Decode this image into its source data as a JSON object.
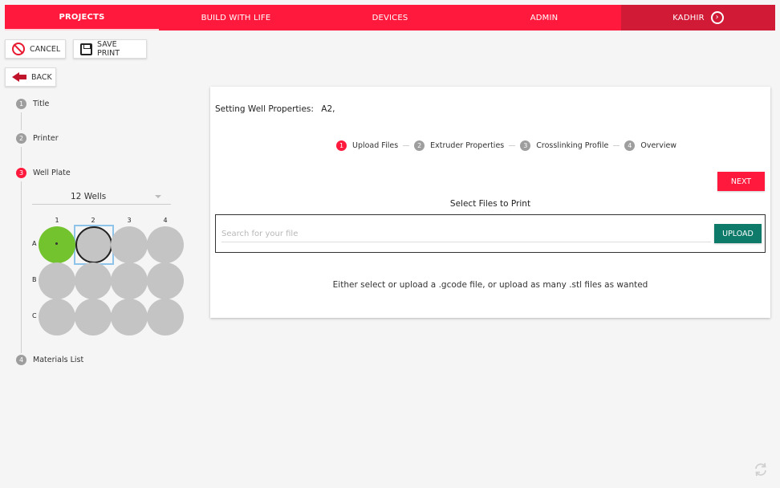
{
  "nav": {
    "items": [
      {
        "label": "PROJECTS",
        "active": true
      },
      {
        "label": "BUILD WITH LIFE",
        "active": false
      },
      {
        "label": "DEVICES",
        "active": false
      },
      {
        "label": "ADMIN",
        "active": false
      }
    ],
    "user": "KADHIR"
  },
  "toolbar": {
    "cancel_label": "CANCEL",
    "save_label": "SAVE PRINT",
    "back_label": "BACK"
  },
  "stepper": {
    "steps": [
      {
        "num": "1",
        "label": "Title"
      },
      {
        "num": "2",
        "label": "Printer"
      },
      {
        "num": "3",
        "label": "Well Plate"
      },
      {
        "num": "4",
        "label": "Materials List"
      }
    ]
  },
  "wellplate": {
    "selected": "12 Wells",
    "columns": [
      "1",
      "2",
      "3",
      "4"
    ],
    "rows": [
      "A",
      "B",
      "C"
    ],
    "filled_well": "A1",
    "selected_well": "A2",
    "colors": {
      "filled": "#72c32e",
      "empty": "#c4c4c4",
      "selection": "#8ec3ea"
    }
  },
  "panel": {
    "title_label": "Setting Well Properties:",
    "title_value": "A2,",
    "steps": [
      {
        "num": "1",
        "label": "Upload Files"
      },
      {
        "num": "2",
        "label": "Extruder Properties"
      },
      {
        "num": "3",
        "label": "Crosslinking Profile"
      },
      {
        "num": "4",
        "label": "Overview"
      }
    ],
    "next_label": "NEXT",
    "section_title": "Select Files to Print",
    "search_placeholder": "Search for your file",
    "upload_label": "UPLOAD",
    "hint": "Either select or upload a .gcode file, or upload as many .stl files as wanted"
  },
  "colors": {
    "accent": "#ff1a3d",
    "accent_dark": "#d01a36",
    "upload": "#0e7a6a"
  },
  "icons": {
    "cancel": "cancel-icon",
    "save": "save-icon",
    "back": "back-arrow-icon",
    "user_arrow": "chevron-right-circle-icon",
    "refresh": "refresh-icon"
  }
}
